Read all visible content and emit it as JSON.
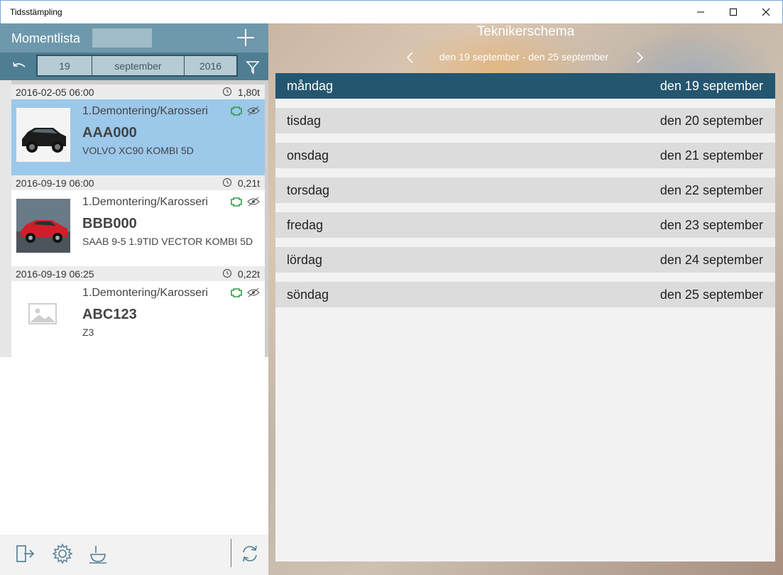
{
  "window": {
    "title": "Tidsstämpling",
    "controls": {
      "minimize": "minimize-icon",
      "maximize": "maximize-icon",
      "close": "close-icon"
    }
  },
  "left": {
    "header_title": "Momentlista",
    "add_icon": "plus-icon",
    "date": {
      "day": "19",
      "month": "september",
      "year": "2016"
    },
    "items": [
      {
        "timestamp": "2016-02-05 06:00",
        "duration": "1,80t",
        "moment": "1.Demontering/Karosseri",
        "reg": "AAA000",
        "model": "VOLVO XC90 KOMBI 5D",
        "selected": true
      },
      {
        "timestamp": "2016-09-19 06:00",
        "duration": "0,21t",
        "moment": "1.Demontering/Karosseri",
        "reg": "BBB000",
        "model": "SAAB 9-5 1.9TID VECTOR KOMBI 5D",
        "selected": false
      },
      {
        "timestamp": "2016-09-19 06:25",
        "duration": "0,22t",
        "moment": "1.Demontering/Karosseri",
        "reg": "ABC123",
        "model": "Z3",
        "selected": false
      }
    ],
    "bottom_icons": [
      "logout-icon",
      "settings-icon",
      "coffee-break-icon",
      "refresh-icon"
    ]
  },
  "schedule": {
    "title": "Teknikerschema",
    "week_range": "den 19 september - den 25 september",
    "days": [
      {
        "name": "måndag",
        "date": "den 19 september",
        "active": true
      },
      {
        "name": "tisdag",
        "date": "den 20 september",
        "active": false
      },
      {
        "name": "onsdag",
        "date": "den 21 september",
        "active": false
      },
      {
        "name": "torsdag",
        "date": "den 22 september",
        "active": false
      },
      {
        "name": "fredag",
        "date": "den 23 september",
        "active": false
      },
      {
        "name": "lördag",
        "date": "den 24 september",
        "active": false
      },
      {
        "name": "söndag",
        "date": "den 25 september",
        "active": false
      }
    ]
  },
  "colors": {
    "header": "#6e98ab",
    "datebar": "#4f7d92",
    "selected_item": "#9cc8ea",
    "active_day": "#24566f",
    "day_row": "#dcdcdc",
    "status_green": "#2f9e44"
  }
}
